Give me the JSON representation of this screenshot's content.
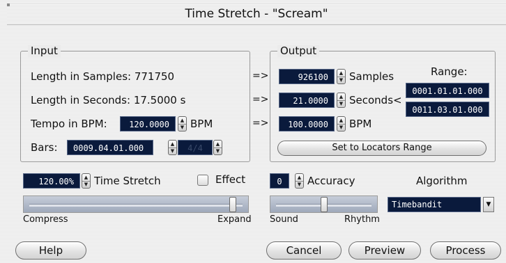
{
  "window": {
    "title": "Time Stretch - \"Scream\""
  },
  "input": {
    "legend": "Input",
    "length_samples_label": "Length in Samples:",
    "length_samples_value": "771750",
    "length_seconds_label": "Length in Seconds:",
    "length_seconds_value": "17.5000 s",
    "tempo_label": "Tempo in BPM:",
    "tempo_value": "120.0000",
    "tempo_unit": "BPM",
    "bars_label": "Bars:",
    "bars_value": "0009.04.01.000",
    "signature_value": "4/4"
  },
  "arrows": {
    "a1": "=>",
    "a2": "=>",
    "a3": "=>"
  },
  "output": {
    "legend": "Output",
    "samples_value": "926100",
    "samples_label": "Samples",
    "seconds_value": "21.0000",
    "seconds_label": "Seconds",
    "seconds_lt": "<",
    "bpm_value": "100.0000",
    "bpm_label": "BPM",
    "range_label": "Range:",
    "range_start": "0001.01.01.000",
    "range_end": "0011.03.01.000",
    "locators_button": "Set to Locators Range"
  },
  "stretch": {
    "value": "120.00%",
    "label": "Time Stretch",
    "effect_label": "Effect",
    "effect_checked": false,
    "slider_left": "Compress",
    "slider_right": "Expand",
    "slider_position": 0.95
  },
  "accuracy": {
    "value": "0",
    "label": "Accuracy",
    "slider_left": "Sound",
    "slider_right": "Rhythm",
    "slider_position": 0.5
  },
  "algorithm": {
    "label": "Algorithm",
    "selected": "Timebandit"
  },
  "buttons": {
    "help": "Help",
    "cancel": "Cancel",
    "preview": "Preview",
    "process": "Process"
  }
}
